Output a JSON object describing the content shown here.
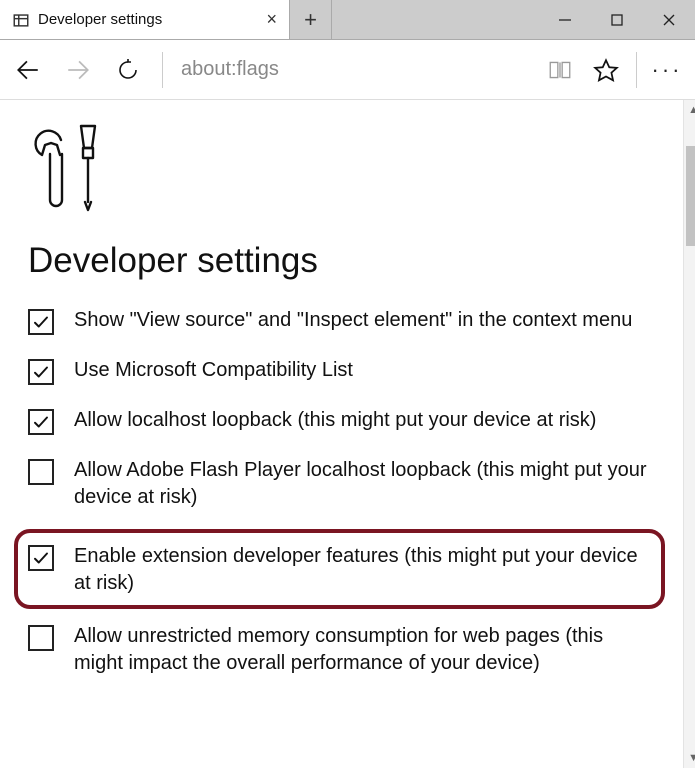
{
  "tab": {
    "title": "Developer settings"
  },
  "toolbar": {
    "address_text": "about:flags"
  },
  "page": {
    "title": "Developer settings",
    "options": [
      {
        "checked": true,
        "highlighted": false,
        "label": "Show \"View source\" and \"Inspect element\" in the context menu"
      },
      {
        "checked": true,
        "highlighted": false,
        "label": "Use Microsoft Compatibility List"
      },
      {
        "checked": true,
        "highlighted": false,
        "label": "Allow localhost loopback (this might put your device at risk)"
      },
      {
        "checked": false,
        "highlighted": false,
        "label": "Allow Adobe Flash Player localhost loopback (this might put your device at risk)"
      },
      {
        "checked": true,
        "highlighted": true,
        "label": "Enable extension developer features (this might put your device at risk)"
      },
      {
        "checked": false,
        "highlighted": false,
        "label": "Allow unrestricted memory consumption for web pages (this might impact the overall performance of your device)"
      }
    ]
  }
}
